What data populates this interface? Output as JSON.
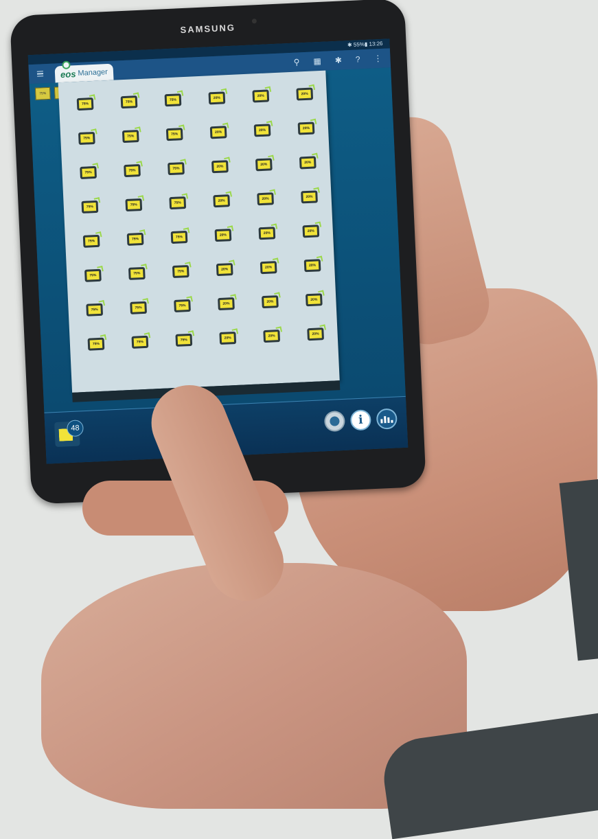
{
  "device": {
    "brand": "SAMSUNG"
  },
  "status": {
    "text": "✱ 55%▮ 13:26"
  },
  "app": {
    "logo_eos": "eos",
    "logo_manager": "Manager"
  },
  "toolbar": {
    "search": "⚲",
    "layout": "▦",
    "settings": "✱",
    "help": "?",
    "more": "⋮"
  },
  "mini_tiles": [
    "75%",
    "75%"
  ],
  "grid": {
    "columns": 6,
    "rows": 8,
    "column_values": [
      "75%",
      "75%",
      "75%",
      "20%",
      "20%",
      "20%"
    ]
  },
  "bottombar": {
    "device_count": "48",
    "caret": "˄",
    "info": "i"
  },
  "colors": {
    "accent_yellow": "#f1e339",
    "app_blue": "#1d5487",
    "check_green": "#9bd84a"
  }
}
